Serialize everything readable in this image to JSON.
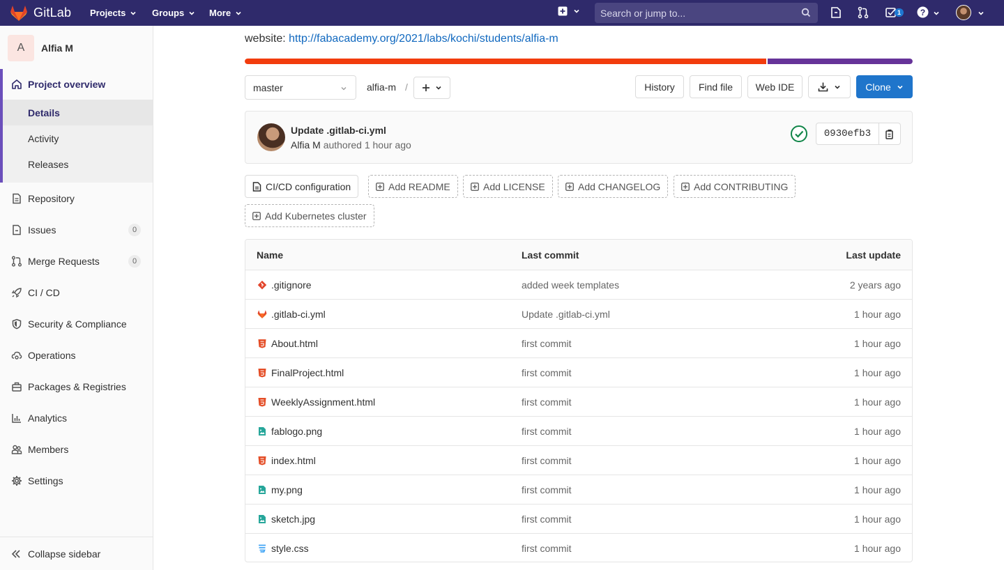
{
  "navbar": {
    "brand": "GitLab",
    "links": [
      "Projects",
      "Groups",
      "More"
    ],
    "search_placeholder": "Search or jump to...",
    "todo_count": "1"
  },
  "sidebar": {
    "project_initial": "A",
    "project_name": "Alfia M",
    "overview": {
      "label": "Project overview",
      "items": [
        "Details",
        "Activity",
        "Releases"
      ],
      "active": "Details"
    },
    "items": [
      {
        "label": "Repository",
        "icon": "doc-icon"
      },
      {
        "label": "Issues",
        "icon": "issues-icon",
        "count": "0"
      },
      {
        "label": "Merge Requests",
        "icon": "merge-request-icon",
        "count": "0"
      },
      {
        "label": "CI / CD",
        "icon": "rocket-icon"
      },
      {
        "label": "Security & Compliance",
        "icon": "shield-icon"
      },
      {
        "label": "Operations",
        "icon": "cloud-gear-icon"
      },
      {
        "label": "Packages & Registries",
        "icon": "package-icon"
      },
      {
        "label": "Analytics",
        "icon": "chart-icon"
      },
      {
        "label": "Members",
        "icon": "users-icon"
      },
      {
        "label": "Settings",
        "icon": "gear-icon"
      }
    ],
    "collapse_label": "Collapse sidebar"
  },
  "main": {
    "website_label": "website:",
    "website_url": "http://fabacademy.org/2021/labs/kochi/students/alfia-m",
    "language_colors": [
      "#f23c0d",
      "#663399"
    ],
    "branch": "master",
    "path": "alfia-m",
    "path_sep": "/",
    "buttons": {
      "history": "History",
      "find_file": "Find file",
      "web_ide": "Web IDE",
      "clone": "Clone"
    },
    "last_commit": {
      "title": "Update .gitlab-ci.yml",
      "author": "Alfia M",
      "meta": "authored 1 hour ago",
      "sha": "0930efb3",
      "status": "passed"
    },
    "quick_actions": [
      {
        "label": "CI/CD configuration",
        "style": "solid"
      },
      {
        "label": "Add README",
        "style": "dashed"
      },
      {
        "label": "Add LICENSE",
        "style": "dashed"
      },
      {
        "label": "Add CHANGELOG",
        "style": "dashed"
      },
      {
        "label": "Add CONTRIBUTING",
        "style": "dashed"
      },
      {
        "label": "Add Kubernetes cluster",
        "style": "dashed"
      }
    ],
    "tree": {
      "headers": {
        "name": "Name",
        "last_commit": "Last commit",
        "last_update": "Last update"
      },
      "rows": [
        {
          "name": ".gitignore",
          "type": "git",
          "commit": "added week templates",
          "updated": "2 years ago"
        },
        {
          "name": ".gitlab-ci.yml",
          "type": "gitlab",
          "commit": "Update .gitlab-ci.yml",
          "updated": "1 hour ago"
        },
        {
          "name": "About.html",
          "type": "html",
          "commit": "first commit",
          "updated": "1 hour ago"
        },
        {
          "name": "FinalProject.html",
          "type": "html",
          "commit": "first commit",
          "updated": "1 hour ago"
        },
        {
          "name": "WeeklyAssignment.html",
          "type": "html",
          "commit": "first commit",
          "updated": "1 hour ago"
        },
        {
          "name": "fablogo.png",
          "type": "image",
          "commit": "first commit",
          "updated": "1 hour ago"
        },
        {
          "name": "index.html",
          "type": "html",
          "commit": "first commit",
          "updated": "1 hour ago"
        },
        {
          "name": "my.png",
          "type": "image",
          "commit": "first commit",
          "updated": "1 hour ago"
        },
        {
          "name": "sketch.jpg",
          "type": "image",
          "commit": "first commit",
          "updated": "1 hour ago"
        },
        {
          "name": "style.css",
          "type": "css",
          "commit": "first commit",
          "updated": "1 hour ago"
        }
      ]
    }
  }
}
